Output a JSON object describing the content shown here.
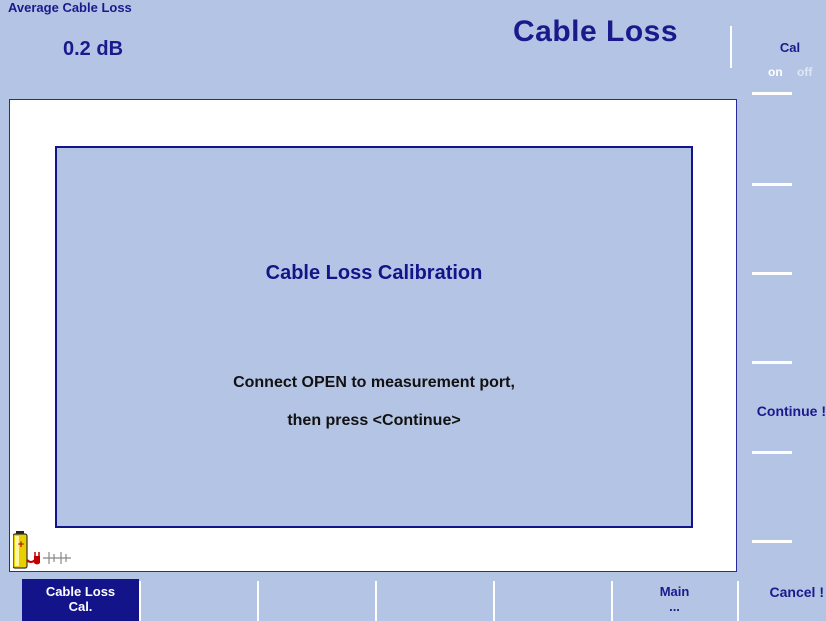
{
  "header": {
    "measurement_label": "Average Cable Loss",
    "measurement_value": "0.2 dB",
    "title": "Cable Loss"
  },
  "cal_toggle": {
    "label": "Cal",
    "on": "on",
    "off": "off",
    "selected": "on"
  },
  "dialog": {
    "title": "Cable Loss Calibration",
    "line1": "Connect OPEN to measurement port,",
    "line2": "then press <Continue>"
  },
  "right_softkeys": {
    "continue": "Continue !",
    "cancel": "Cancel !"
  },
  "bottom_softkeys": [
    {
      "line1": "Cable Loss",
      "line2": "Cal.",
      "active": true
    },
    {
      "line1": "",
      "line2": "",
      "active": false
    },
    {
      "line1": "",
      "line2": "",
      "active": false
    },
    {
      "line1": "",
      "line2": "",
      "active": false
    },
    {
      "line1": "",
      "line2": "",
      "active": false
    },
    {
      "line1": "Main",
      "line2": "...",
      "active": false
    }
  ],
  "status_icons": [
    "battery-icon",
    "plug-icon",
    "antenna-icon"
  ],
  "colors": {
    "background": "#b4c4e4",
    "accent": "#14148a",
    "text_dark": "#111111",
    "white": "#ffffff",
    "battery": "#e8d000"
  }
}
